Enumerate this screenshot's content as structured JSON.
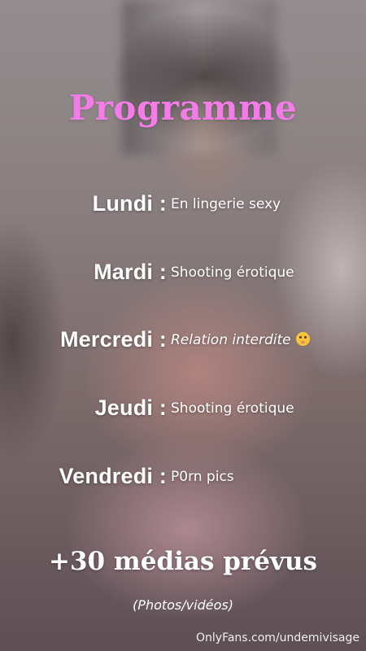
{
  "title": "Programme",
  "schedule": [
    {
      "day": "Lundi :",
      "activity": "En lingerie sexy"
    },
    {
      "day": "Mardi :",
      "activity": "Shooting érotique"
    },
    {
      "day": "Mercredi :",
      "activity": "Relation interdite",
      "emoji": "shushing-face-icon"
    },
    {
      "day": "Jeudi :",
      "activity": "Shooting érotique"
    },
    {
      "day": "Vendredi :",
      "activity": "P0rn pics"
    }
  ],
  "promo": "+30 médias prévus",
  "promo_sub": "(Photos/vidéos)",
  "watermark": "OnlyFans.com/undemivisage",
  "colors": {
    "title": "#f47ce8",
    "text": "#ffffff"
  }
}
